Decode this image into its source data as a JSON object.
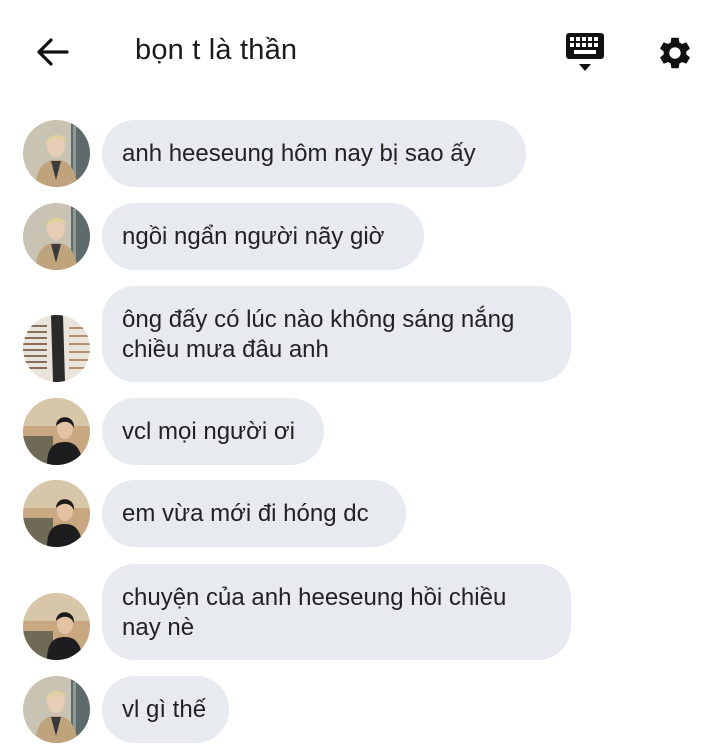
{
  "header": {
    "title": "bọn t là thần",
    "back_icon": "arrow-left-icon",
    "keyboard_icon": "keyboard-icon",
    "settings_icon": "gear-icon"
  },
  "colors": {
    "bubble": "#e7ebf0",
    "text": "#222222",
    "icon": "#111111"
  },
  "messages": [
    {
      "avatar": "avatar-blond-man-suit",
      "text": "anh heeseung hôm nay bị sao ấy"
    },
    {
      "avatar": "avatar-blond-man-suit",
      "text": "ngồi ngẩn người nãy giờ"
    },
    {
      "avatar": "avatar-figure-by-window-blinds",
      "text": "ông đấy có lúc nào không sáng nắng chiều mưa đâu anh"
    },
    {
      "avatar": "avatar-dark-hair-sunset",
      "text": "vcl mọi người ơi"
    },
    {
      "avatar": "avatar-dark-hair-sunset",
      "text": "em vừa mới đi hóng dc"
    },
    {
      "avatar": "avatar-dark-hair-sunset",
      "text": "chuyện của anh heeseung hồi chiều nay nè"
    },
    {
      "avatar": "avatar-blond-man-suit",
      "text": "vl gì thế"
    }
  ]
}
